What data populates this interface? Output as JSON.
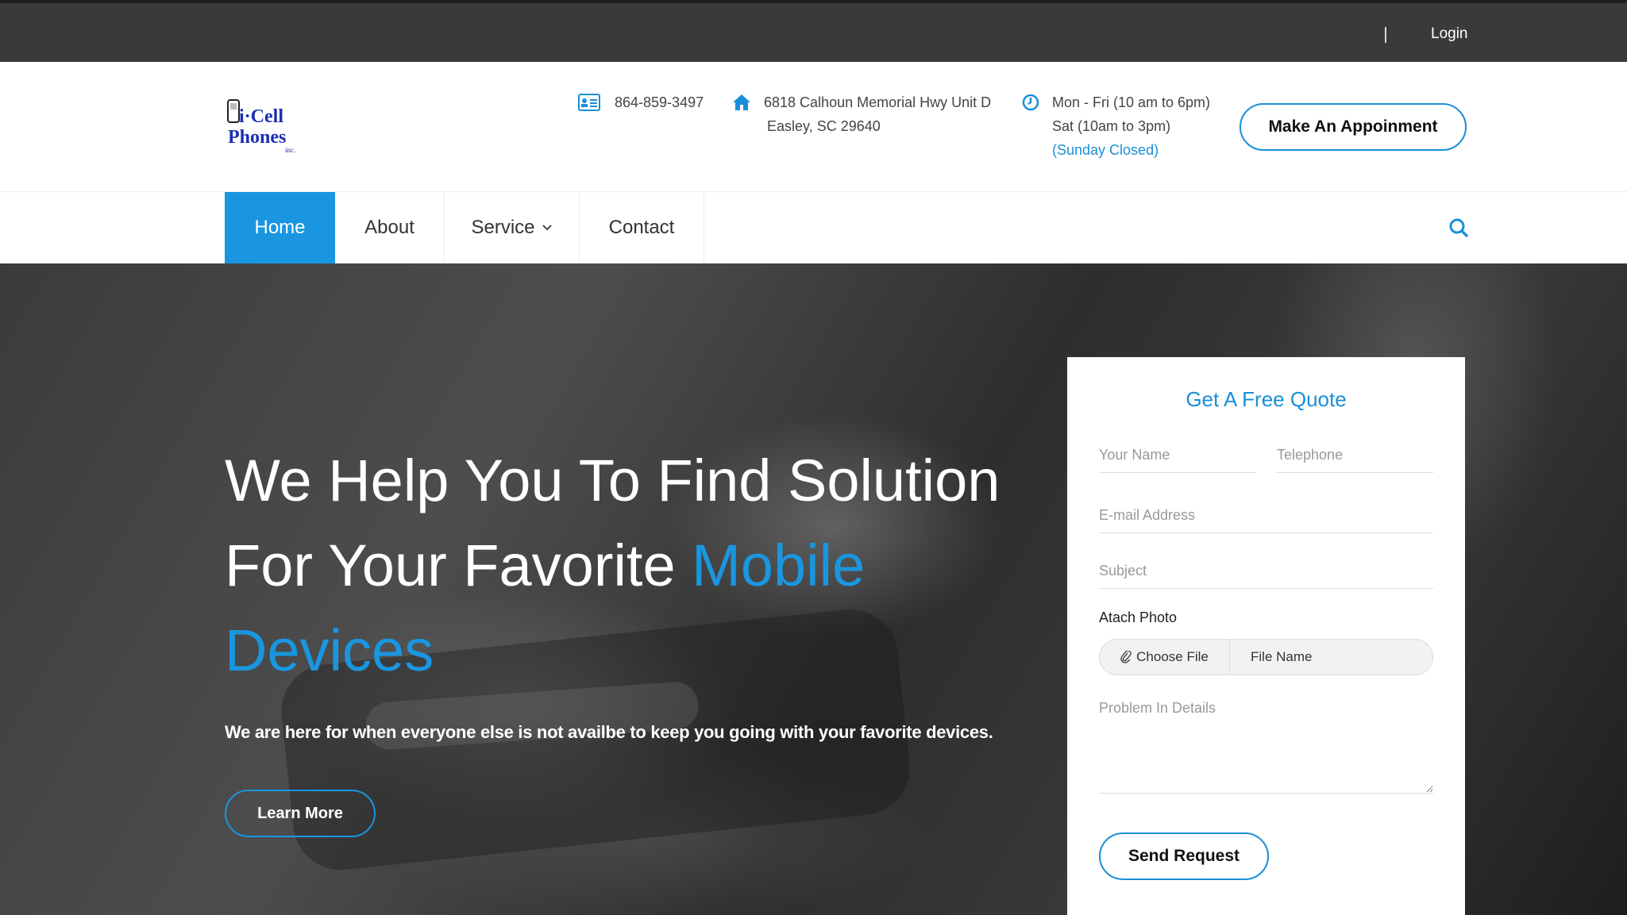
{
  "topbar": {
    "login_label": "Login"
  },
  "header": {
    "logo": {
      "line1": "i·Cell",
      "line2": "Phones",
      "suffix": "inc."
    },
    "phone": {
      "icon": "contact-card-icon",
      "text": "864-859-3497"
    },
    "address": {
      "icon": "home-icon",
      "line1": "6818 Calhoun Memorial Hwy Unit D",
      "line2": "Easley, SC 29640"
    },
    "hours": {
      "icon": "clock-icon",
      "line1": "Mon - Fri (10 am to 6pm)",
      "line2": "Sat (10am to 3pm)",
      "line3": "(Sunday Closed)"
    },
    "appointment_label": "Make An Appoinment"
  },
  "nav": {
    "items": [
      {
        "label": "Home",
        "active": true
      },
      {
        "label": "About",
        "active": false
      },
      {
        "label": "Service",
        "active": false,
        "has_dropdown": true
      },
      {
        "label": "Contact",
        "active": false
      }
    ],
    "search_icon": "search-icon"
  },
  "hero": {
    "title_line1": "We Help You To Find Solution",
    "title_line2_prefix": "For Your Favorite ",
    "title_line2_accent": "Mobile",
    "title_line3_accent": "Devices",
    "subtitle": "We are here for when everyone else is not availbe to keep you going with your favorite devices.",
    "learn_more_label": "Learn More"
  },
  "quote_form": {
    "title": "Get A Free Quote",
    "name_placeholder": "Your Name",
    "telephone_placeholder": "Telephone",
    "email_placeholder": "E-mail Address",
    "subject_placeholder": "Subject",
    "photo_label": "Atach Photo",
    "choose_file_label": "Choose File",
    "file_name_label": "File Name",
    "details_placeholder": "Problem In Details",
    "send_label": "Send Request"
  },
  "colors": {
    "accent": "#1a96e0",
    "topbar": "#3a3a3a",
    "logo_blue": "#1c2fb0"
  }
}
